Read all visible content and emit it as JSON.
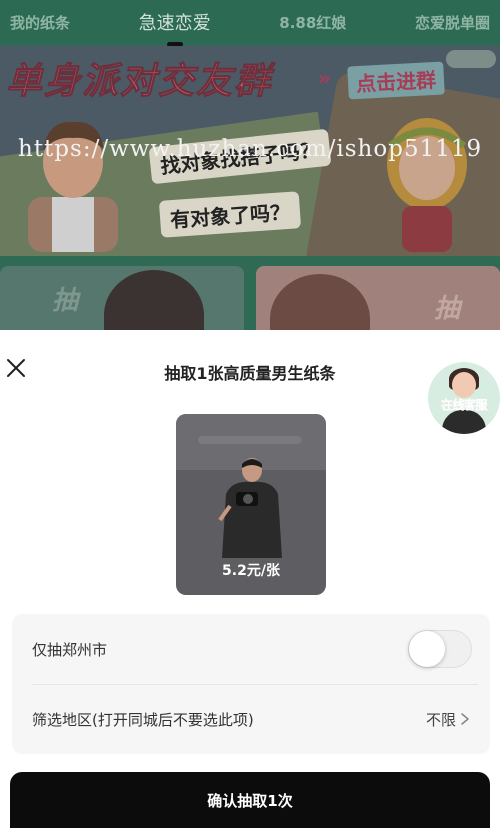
{
  "background": {
    "tabs": [
      {
        "label": "我的纸条",
        "active": false
      },
      {
        "label": "急速恋爱",
        "active": true
      },
      {
        "label": "8.88红娘",
        "active": false
      },
      {
        "label": "恋爱脱单圈",
        "active": false
      }
    ],
    "banner": {
      "title": "单身派对交友群",
      "cta": "点击进群",
      "bubble_1": "找对象找搭子吗？",
      "bubble_2": "有对象了吗？"
    },
    "watermark": "https://www.huzhan.com/ishop51119",
    "cards": [
      {
        "label": "抽"
      },
      {
        "label": "抽"
      }
    ]
  },
  "sheet": {
    "title": "抽取1张高质量男生纸条",
    "service_label": "在线客服",
    "product": {
      "price": "5.2元/张"
    },
    "options": {
      "city_only_label": "仅抽郑州市",
      "city_only_enabled": false,
      "region_label": "筛选地区(打开同城后不要选此项)",
      "region_value": "不限"
    },
    "confirm_label": "确认抽取1次"
  },
  "colors": {
    "nav_green": "#2d6a53",
    "banner_title": "#c25c6d",
    "confirm_button": "#0c0c0c",
    "service_text": "#e84a7a"
  }
}
